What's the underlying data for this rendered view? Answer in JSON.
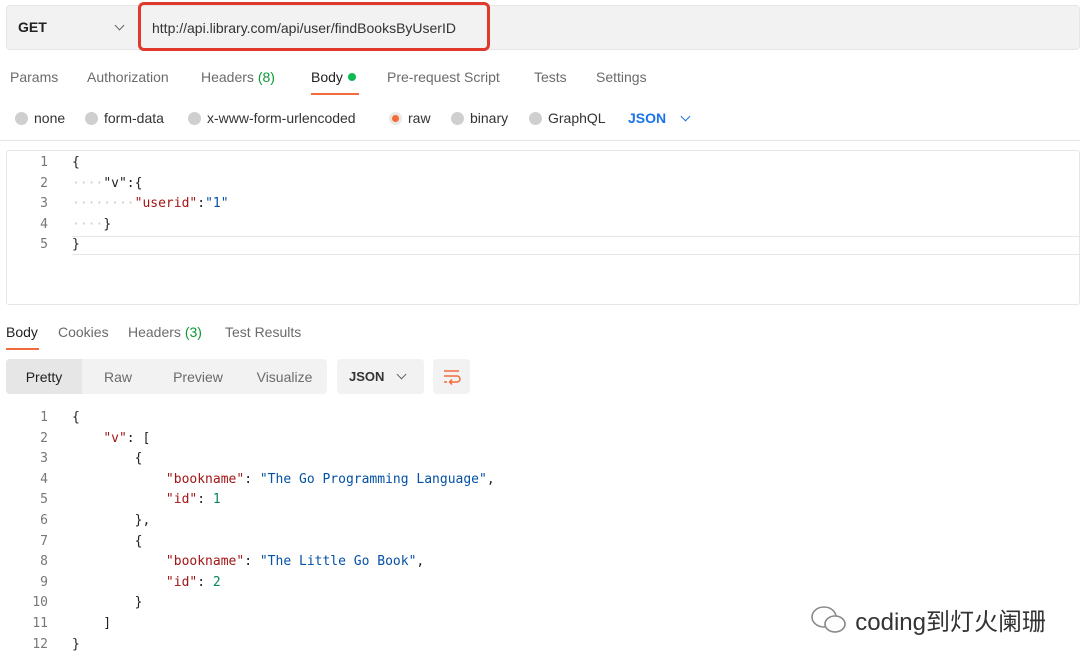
{
  "request": {
    "method": "GET",
    "url": "http://api.library.com/api/user/findBooksByUserID"
  },
  "request_tabs": [
    {
      "label": "Params"
    },
    {
      "label": "Authorization"
    },
    {
      "label": "Headers",
      "count": "(8)"
    },
    {
      "label": "Body",
      "active": true
    },
    {
      "label": "Pre-request Script"
    },
    {
      "label": "Tests"
    },
    {
      "label": "Settings"
    }
  ],
  "body_types": [
    {
      "label": "none"
    },
    {
      "label": "form-data"
    },
    {
      "label": "x-www-form-urlencoded"
    },
    {
      "label": "raw",
      "selected": true
    },
    {
      "label": "binary"
    },
    {
      "label": "GraphQL"
    }
  ],
  "body_format": "JSON",
  "request_body": [
    [
      [
        "{",
        "p"
      ]
    ],
    [
      [
        "····",
        "ind"
      ],
      [
        "\"v\"",
        "p"
      ],
      [
        ":{",
        "p"
      ]
    ],
    [
      [
        "········",
        "ind"
      ],
      [
        "\"userid\"",
        "key"
      ],
      [
        ":",
        "p"
      ],
      [
        "\"1\"",
        "str"
      ]
    ],
    [
      [
        "····",
        "ind"
      ],
      [
        "}",
        "p"
      ]
    ],
    [
      [
        "}",
        "p"
      ]
    ]
  ],
  "response_tabs": [
    {
      "label": "Body",
      "active": true
    },
    {
      "label": "Cookies"
    },
    {
      "label": "Headers",
      "count": "(3)"
    },
    {
      "label": "Test Results"
    }
  ],
  "view_modes": [
    "Pretty",
    "Raw",
    "Preview",
    "Visualize"
  ],
  "response_format": "JSON",
  "response_body": [
    [
      [
        "{",
        "p"
      ]
    ],
    [
      [
        "    ",
        "p"
      ],
      [
        "\"v\"",
        "key"
      ],
      [
        ": [",
        "p"
      ]
    ],
    [
      [
        "        {",
        "p"
      ]
    ],
    [
      [
        "            ",
        "p"
      ],
      [
        "\"bookname\"",
        "key"
      ],
      [
        ": ",
        "p"
      ],
      [
        "\"The Go Programming Language\"",
        "str"
      ],
      [
        ",",
        "p"
      ]
    ],
    [
      [
        "            ",
        "p"
      ],
      [
        "\"id\"",
        "key"
      ],
      [
        ": ",
        "p"
      ],
      [
        "1",
        "num"
      ]
    ],
    [
      [
        "        },",
        "p"
      ]
    ],
    [
      [
        "        {",
        "p"
      ]
    ],
    [
      [
        "            ",
        "p"
      ],
      [
        "\"bookname\"",
        "key"
      ],
      [
        ": ",
        "p"
      ],
      [
        "\"The Little Go Book\"",
        "str"
      ],
      [
        ",",
        "p"
      ]
    ],
    [
      [
        "            ",
        "p"
      ],
      [
        "\"id\"",
        "key"
      ],
      [
        ": ",
        "p"
      ],
      [
        "2",
        "num"
      ]
    ],
    [
      [
        "        }",
        "p"
      ]
    ],
    [
      [
        "    ]",
        "p"
      ]
    ],
    [
      [
        "}",
        "p"
      ]
    ]
  ],
  "watermark": "coding到灯火阑珊",
  "colors": {
    "accent": "#f26b3a",
    "highlight_border": "#e0392b",
    "link_blue": "#1a73e8"
  }
}
